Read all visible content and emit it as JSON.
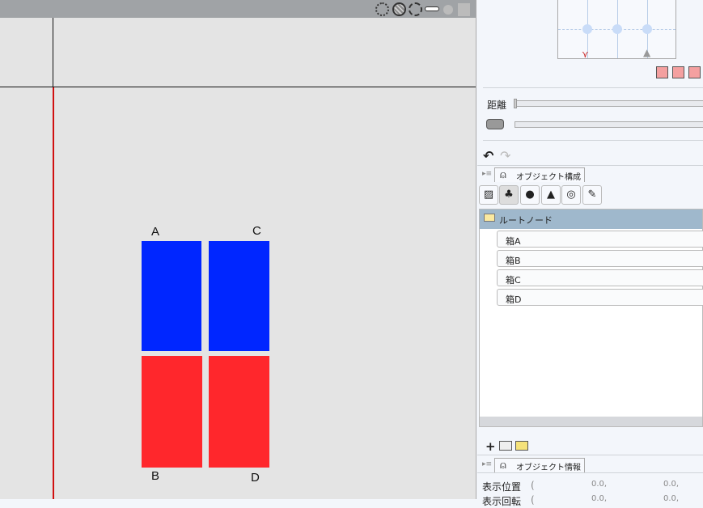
{
  "viewport": {
    "labels": {
      "a": "A",
      "b": "B",
      "c": "C",
      "d": "D"
    },
    "colors": {
      "top_boxes": "#0026ff",
      "bottom_boxes": "#ff272c",
      "guide": "#d01010"
    }
  },
  "panel": {
    "distance_label": "距離",
    "object_tab": "オブジェクト構成",
    "tree": {
      "root": "ルートノード",
      "children": [
        "箱A",
        "箱B",
        "箱C",
        "箱D"
      ]
    },
    "info_tab": "オブジェクト情報",
    "info_rows": [
      {
        "label": "表示位置",
        "paren": "(",
        "x": "0.0,",
        "y": "0.0,"
      },
      {
        "label": "表示回転",
        "paren": "(",
        "x": "0.0,",
        "y": "0.0,"
      }
    ]
  }
}
